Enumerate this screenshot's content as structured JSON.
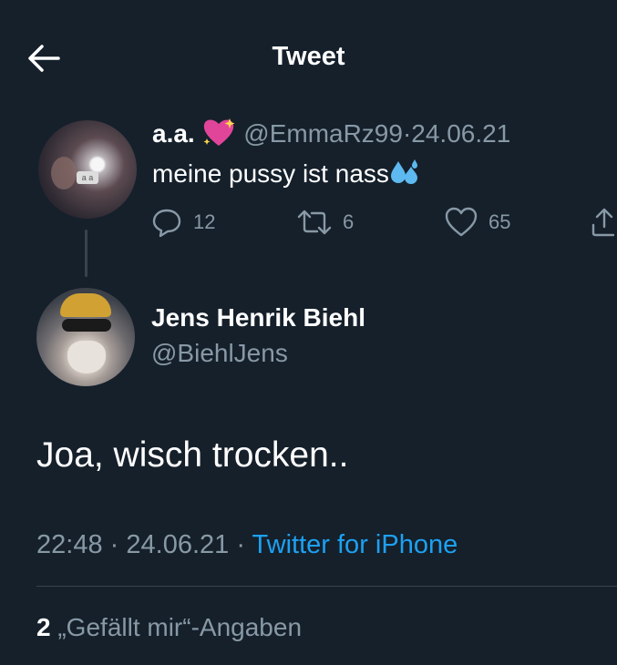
{
  "header": {
    "title": "Tweet"
  },
  "parent_tweet": {
    "name": "a.a.",
    "handle": "@EmmaRz99",
    "separator": "·",
    "date": "24.06.21",
    "text": "meine pussy ist nass",
    "phone_case_text": "a a",
    "reply_count": "12",
    "retweet_count": "6",
    "like_count": "65"
  },
  "reply_tweet": {
    "name": "Jens Henrik Biehl",
    "handle": "@BiehlJens",
    "text": "Joa, wisch trocken..",
    "time": "22:48",
    "separator": "·",
    "date": "24.06.21",
    "source": "Twitter for iPhone"
  },
  "likes": {
    "count": "2",
    "label": "„Gefällt mir“-Angaben"
  },
  "colors": {
    "background": "#15202b",
    "secondary_text": "#8899a6",
    "link": "#1da1f2",
    "divider": "#38444d"
  }
}
